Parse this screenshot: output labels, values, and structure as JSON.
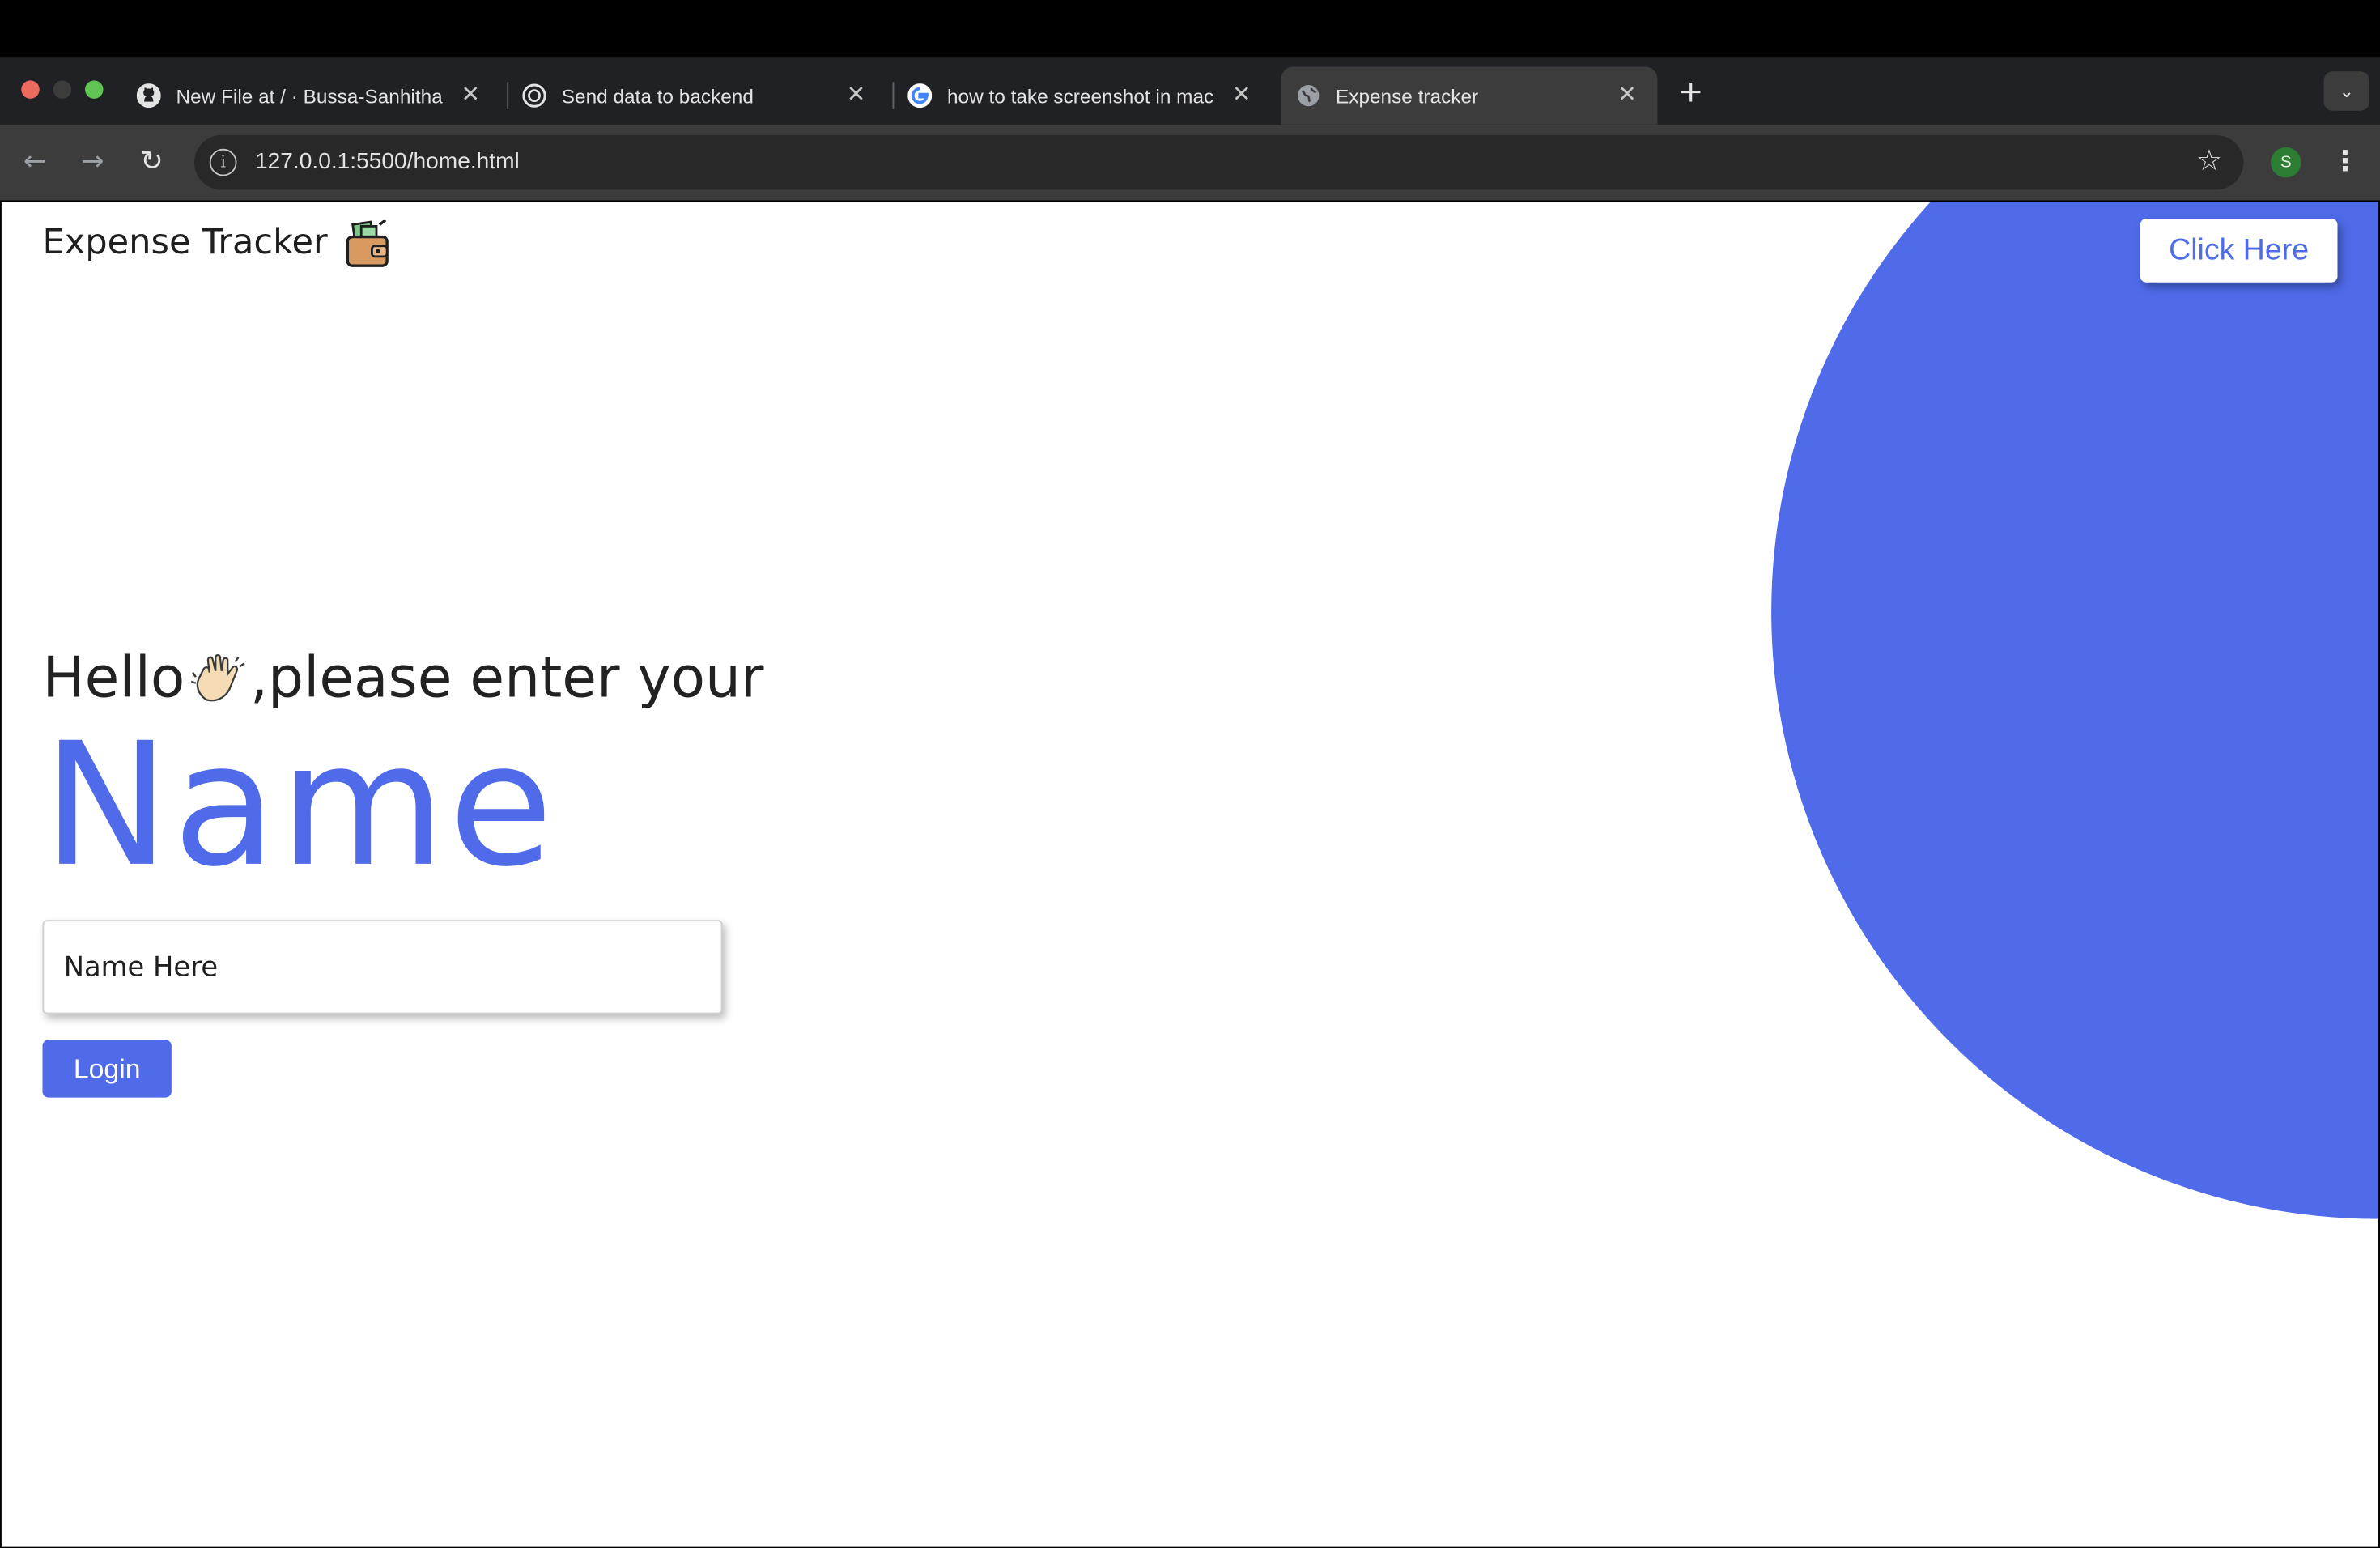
{
  "browser": {
    "tabs": [
      {
        "title": "New File at / · Bussa-Sanhitha",
        "icon": "github-icon"
      },
      {
        "title": "Send data to backend",
        "icon": "chatgpt-icon"
      },
      {
        "title": "how to take screenshot in mac",
        "icon": "google-icon"
      },
      {
        "title": "Expense tracker",
        "icon": "globe-icon",
        "active": true
      }
    ],
    "url": "127.0.0.1:5500/home.html",
    "profile_initial": "S"
  },
  "page": {
    "brand": "Expense Tracker",
    "click_here": "Click Here",
    "greeting_before": "Hello",
    "greeting_after": ",please enter your",
    "headline": "Name",
    "input_placeholder": "Name Here",
    "login": "Login"
  },
  "colors": {
    "accent": "#4f6bea",
    "tab_strip": "#202124",
    "toolbar": "#3c3c3c"
  }
}
